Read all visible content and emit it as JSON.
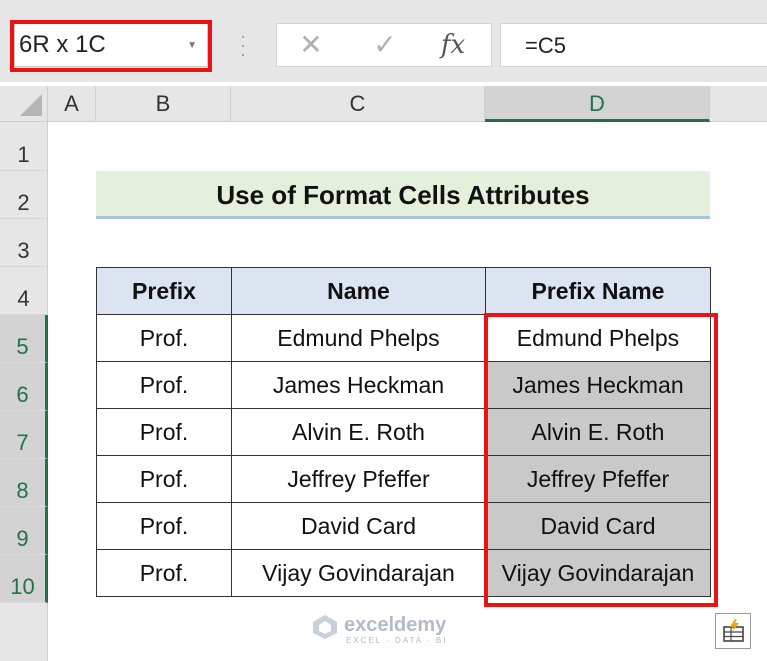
{
  "name_box": {
    "value": "6R x 1C"
  },
  "formula_bar": {
    "cancel_icon": "x-icon",
    "enter_icon": "check-icon",
    "insert_function_label": "fx",
    "formula": "=C5"
  },
  "columns": [
    "A",
    "B",
    "C",
    "D"
  ],
  "rows": [
    "1",
    "2",
    "3",
    "4",
    "5",
    "6",
    "7",
    "8",
    "9",
    "10"
  ],
  "title": "Use of Format Cells Attributes",
  "table": {
    "headers": [
      "Prefix",
      "Name",
      "Prefix Name"
    ],
    "rows": [
      [
        "Prof.",
        "Edmund Phelps",
        "Edmund Phelps"
      ],
      [
        "Prof.",
        "James Heckman",
        "James Heckman"
      ],
      [
        "Prof.",
        "Alvin E. Roth",
        "Alvin E. Roth"
      ],
      [
        "Prof.",
        "Jeffrey Pfeffer",
        "Jeffrey Pfeffer"
      ],
      [
        "Prof.",
        "David Card",
        "David Card"
      ],
      [
        "Prof.",
        "Vijay Govindarajan",
        "Vijay Govindarajan"
      ]
    ]
  },
  "watermark": {
    "name": "exceldemy",
    "tagline": "EXCEL · DATA · BI"
  },
  "colors": {
    "highlight": "#ee1111",
    "title_fill": "#e4efdc",
    "header_fill": "#dce4f2",
    "selection_fill": "#c9c9c9",
    "excel_green": "#217346"
  }
}
